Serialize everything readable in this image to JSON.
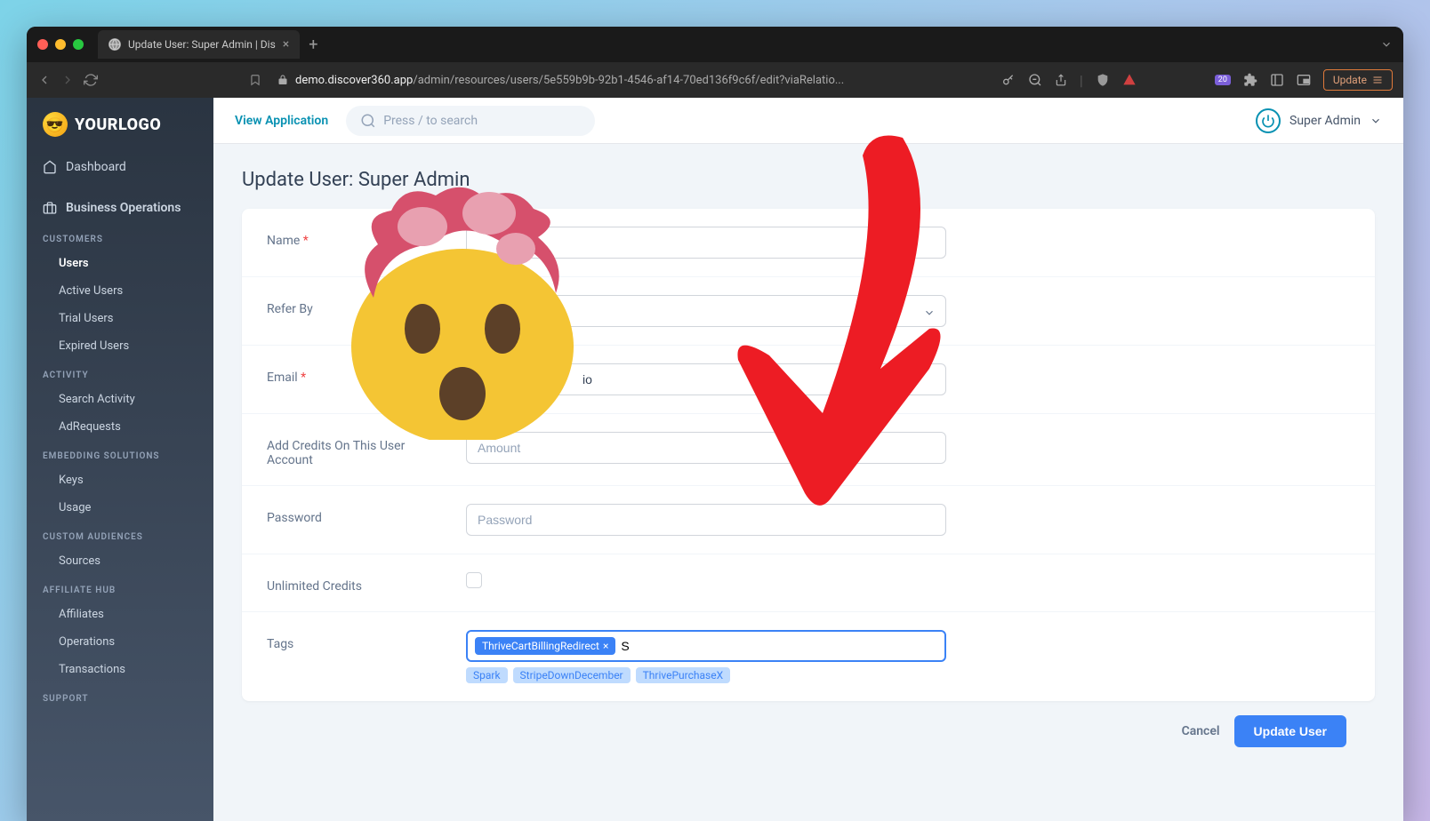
{
  "browser": {
    "tab_title": "Update User: Super Admin | Dis",
    "url_domain": "demo.discover360.app",
    "url_path": "/admin/resources/users/5e559b9b-92b1-4546-af14-70ed136f9c6f/edit?viaRelatio...",
    "update_button": "Update",
    "ext_badge": "20"
  },
  "logo_text": "YOURLOGO",
  "top_bar": {
    "view_app": "View Application",
    "search_placeholder": "Press / to search",
    "user_name": "Super Admin"
  },
  "sidebar": {
    "dashboard": "Dashboard",
    "business_ops": "Business Operations",
    "sections": {
      "customers": {
        "header": "CUSTOMERS",
        "items": [
          "Users",
          "Active Users",
          "Trial Users",
          "Expired Users"
        ]
      },
      "activity": {
        "header": "ACTIVITY",
        "items": [
          "Search Activity",
          "AdRequests"
        ]
      },
      "embedding": {
        "header": "EMBEDDING SOLUTIONS",
        "items": [
          "Keys",
          "Usage"
        ]
      },
      "audiences": {
        "header": "CUSTOM AUDIENCES",
        "items": [
          "Sources"
        ]
      },
      "affiliate": {
        "header": "AFFILIATE HUB",
        "items": [
          "Affiliates",
          "Operations",
          "Transactions"
        ]
      },
      "support": {
        "header": "SUPPORT"
      }
    }
  },
  "page": {
    "title": "Update User: Super Admin",
    "form": {
      "name_label": "Name",
      "refer_label": "Refer By",
      "email_label": "Email",
      "email_value_partial": "io",
      "credits_label": "Add Credits On This User Account",
      "credits_placeholder": "Amount",
      "password_label": "Password",
      "password_placeholder": "Password",
      "unlimited_label": "Unlimited Credits",
      "tags_label": "Tags",
      "selected_tag": "ThriveCartBillingRedirect",
      "tags_input_value": "S",
      "tag_suggestions": [
        "Spark",
        "StripeDownDecember",
        "ThrivePurchaseX"
      ]
    },
    "actions": {
      "cancel": "Cancel",
      "submit": "Update User"
    }
  }
}
